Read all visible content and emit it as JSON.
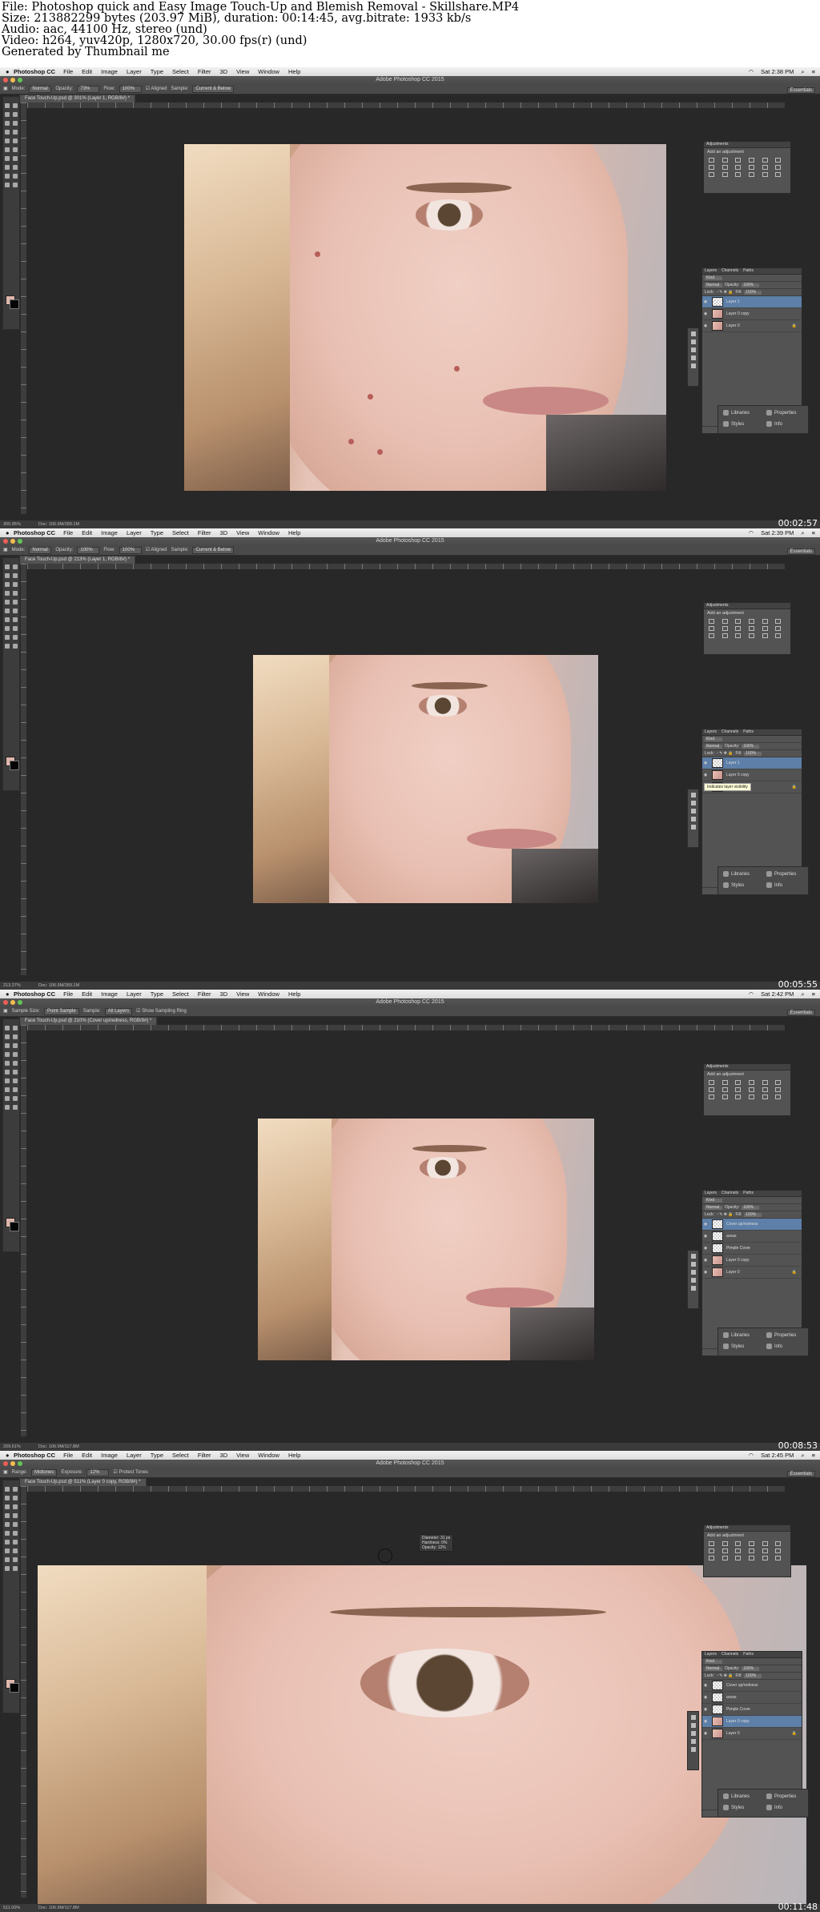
{
  "header": {
    "line1": "File: Photoshop quick and Easy Image Touch-Up and Blemish Removal - Skillshare.MP4",
    "line2": "Size: 213882299 bytes (203.97 MiB), duration: 00:14:45, avg.bitrate: 1933 kb/s",
    "line3": "Audio: aac, 44100 Hz, stereo (und)",
    "line4": "Video: h264, yuv420p, 1280x720, 30.00 fps(r) (und)",
    "line5": "Generated by Thumbnail me"
  },
  "app": {
    "name": "Photoshop CC",
    "window_title": "Adobe Photoshop CC 2015",
    "menus": [
      "File",
      "Edit",
      "Image",
      "Layer",
      "Type",
      "Select",
      "Filter",
      "3D",
      "View",
      "Window",
      "Help"
    ],
    "workspace": "Essentials"
  },
  "panels": {
    "adjustments_tab": "Adjustments",
    "add_adjustment": "Add an adjustment",
    "layers_tabs": [
      "Layers",
      "Channels",
      "Paths"
    ],
    "kind": "Kind",
    "blend_mode": "Normal",
    "opacity_label": "Opacity:",
    "opacity_value": "100%",
    "lock_label": "Lock:",
    "fill_label": "Fill:",
    "fill_value": "100%",
    "libraries": "Libraries",
    "properties": "Properties",
    "styles": "Styles",
    "info": "Info"
  },
  "frames": [
    {
      "clock": "Sat 2:38 PM",
      "timecode": "00:02:57",
      "doc_tab": "Face Touch-Up.psd @ 301% (Layer 1, RGB/8#) *",
      "zoom": "300.95%",
      "doc_size": "Doc: 106.9M/289.1M",
      "options": {
        "mode_label": "Mode:",
        "mode_value": "Normal",
        "opacity_label": "Opacity:",
        "opacity_value": "73%",
        "flow_label": "Flow:",
        "flow_value": "100%",
        "aligned": "Aligned",
        "sample_label": "Sample:",
        "sample_value": "Current & Below"
      },
      "layers": [
        {
          "name": "Layer 1",
          "selected": true
        },
        {
          "name": "Layer 0 copy",
          "selected": false
        },
        {
          "name": "Layer 0",
          "selected": false
        }
      ]
    },
    {
      "clock": "Sat 2:39 PM",
      "timecode": "00:05:55",
      "doc_tab": "Face Touch-Up.psd @ 213% (Layer 1, RGB/8#) *",
      "zoom": "213.27%",
      "doc_size": "Doc: 106.9M/289.1M",
      "options": {
        "mode_label": "Mode:",
        "mode_value": "Normal",
        "opacity_label": "Opacity:",
        "opacity_value": "100%",
        "flow_label": "Flow:",
        "flow_value": "100%",
        "aligned": "Aligned",
        "sample_label": "Sample:",
        "sample_value": "Current & Below"
      },
      "tooltip": "Indicates layer visibility",
      "layers": [
        {
          "name": "Layer 1",
          "selected": true
        },
        {
          "name": "Layer 0 copy",
          "selected": false
        },
        {
          "name": "Layer 0",
          "selected": false
        }
      ]
    },
    {
      "clock": "Sat 2:42 PM",
      "timecode": "00:08:53",
      "doc_tab": "Face Touch-Up.psd @ 210% (Cover up/redness, RGB/8#) *",
      "zoom": "209.61%",
      "doc_size": "Doc: 106.9M/117.8M",
      "options": {
        "sample_size_label": "Sample Size:",
        "sample_size_value": "Point Sample",
        "sample_label": "Sample:",
        "sample_value": "All Layers",
        "ring": "Show Sampling Ring"
      },
      "layers": [
        {
          "name": "Cover up/redness",
          "selected": true
        },
        {
          "name": "areas",
          "selected": false
        },
        {
          "name": "Pimple Cover",
          "selected": false
        },
        {
          "name": "Layer 0 copy",
          "selected": false
        },
        {
          "name": "Layer 0",
          "selected": false
        }
      ]
    },
    {
      "clock": "Sat 2:45 PM",
      "timecode": "00:11:48",
      "doc_tab": "Face Touch-Up.psd @ 511% (Layer 0 copy, RGB/8#) *",
      "zoom": "511.00%",
      "doc_size": "Doc: 106.9M/117.8M",
      "options": {
        "range_label": "Range:",
        "range_value": "Midtones",
        "exposure_label": "Exposure:",
        "exposure_value": "12%",
        "protect": "Protect Tones"
      },
      "brush_info": {
        "diameter": "Diameter: 31 px",
        "hardness": "Hardness: 0%",
        "opacity": "Opacity: 12%"
      },
      "layers": [
        {
          "name": "Cover up/redness",
          "selected": false
        },
        {
          "name": "areas",
          "selected": false
        },
        {
          "name": "Pimple Cover",
          "selected": false
        },
        {
          "name": "Layer 0 copy",
          "selected": true
        },
        {
          "name": "Layer 0",
          "selected": false
        }
      ]
    }
  ]
}
